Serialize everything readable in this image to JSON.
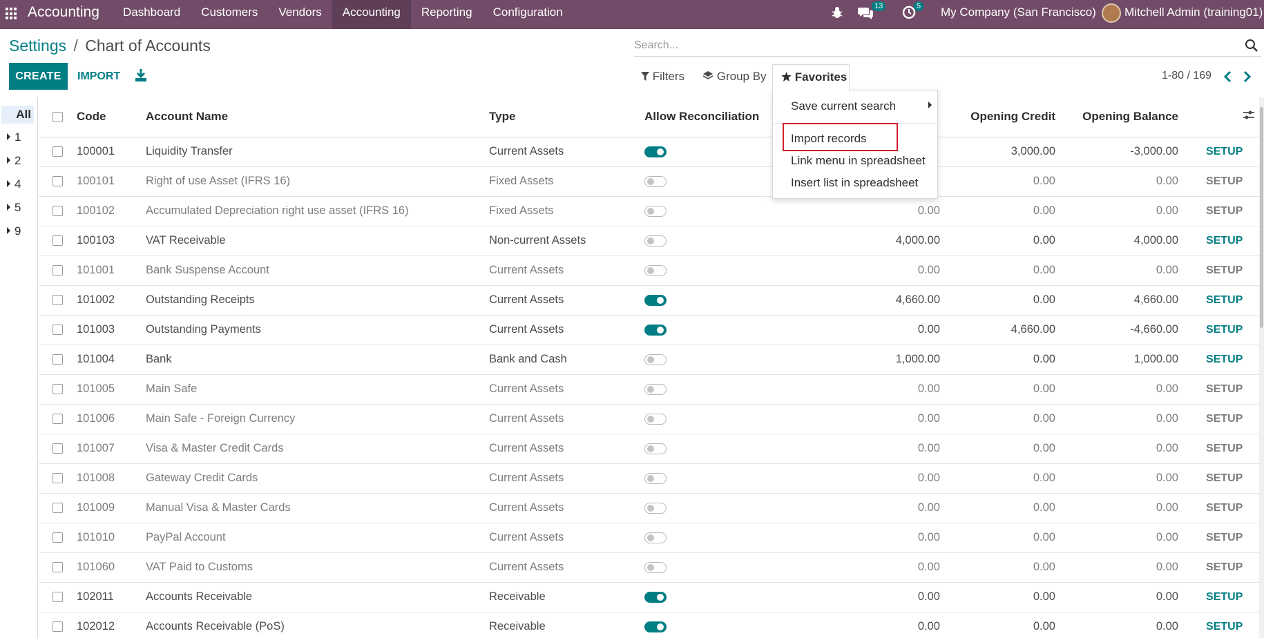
{
  "navbar": {
    "app_name": "Accounting",
    "menu": [
      "Dashboard",
      "Customers",
      "Vendors",
      "Accounting",
      "Reporting",
      "Configuration"
    ],
    "active_menu": "Accounting",
    "messages_count": "13",
    "activities_count": "5",
    "company": "My Company (San Francisco)",
    "user": "Mitchell Admin (training01)"
  },
  "breadcrumb": {
    "parent": "Settings",
    "separator": "/",
    "current": "Chart of Accounts"
  },
  "toolbar": {
    "create_label": "CREATE",
    "import_label": "IMPORT"
  },
  "search": {
    "placeholder": "Search..."
  },
  "filters": {
    "filters_label": "Filters",
    "groupby_label": "Group By",
    "favorites_label": "Favorites"
  },
  "pager": {
    "text": "1-80 / 169"
  },
  "favorites_menu": {
    "items": [
      "Save current search",
      "Import records",
      "Link menu in spreadsheet",
      "Insert list in spreadsheet"
    ]
  },
  "side_panel": {
    "all_label": "All",
    "items": [
      "1",
      "2",
      "4",
      "5",
      "9"
    ]
  },
  "table": {
    "columns": {
      "code": "Code",
      "name": "Account Name",
      "type": "Type",
      "reconcile": "Allow Reconciliation",
      "credit": "Opening Credit",
      "balance": "Opening Balance"
    },
    "setup_label": "SETUP",
    "rows": [
      {
        "code": "100001",
        "name": "Liquidity Transfer",
        "type": "Current Assets",
        "reconcile": true,
        "debit": "",
        "credit": "3,000.00",
        "balance": "-3,000.00"
      },
      {
        "code": "100101",
        "name": "Right of use Asset (IFRS 16)",
        "type": "Fixed Assets",
        "reconcile": false,
        "debit": "",
        "credit": "0.00",
        "balance": "0.00"
      },
      {
        "code": "100102",
        "name": "Accumulated Depreciation right use asset (IFRS 16)",
        "type": "Fixed Assets",
        "reconcile": false,
        "debit": "0.00",
        "credit": "0.00",
        "balance": "0.00"
      },
      {
        "code": "100103",
        "name": "VAT Receivable",
        "type": "Non-current Assets",
        "reconcile": false,
        "debit": "4,000.00",
        "credit": "0.00",
        "balance": "4,000.00"
      },
      {
        "code": "101001",
        "name": "Bank Suspense Account",
        "type": "Current Assets",
        "reconcile": false,
        "debit": "0.00",
        "credit": "0.00",
        "balance": "0.00"
      },
      {
        "code": "101002",
        "name": "Outstanding Receipts",
        "type": "Current Assets",
        "reconcile": true,
        "debit": "4,660.00",
        "credit": "0.00",
        "balance": "4,660.00"
      },
      {
        "code": "101003",
        "name": "Outstanding Payments",
        "type": "Current Assets",
        "reconcile": true,
        "debit": "0.00",
        "credit": "4,660.00",
        "balance": "-4,660.00"
      },
      {
        "code": "101004",
        "name": "Bank",
        "type": "Bank and Cash",
        "reconcile": false,
        "debit": "1,000.00",
        "credit": "0.00",
        "balance": "1,000.00"
      },
      {
        "code": "101005",
        "name": "Main Safe",
        "type": "Current Assets",
        "reconcile": false,
        "debit": "0.00",
        "credit": "0.00",
        "balance": "0.00"
      },
      {
        "code": "101006",
        "name": "Main Safe - Foreign Currency",
        "type": "Current Assets",
        "reconcile": false,
        "debit": "0.00",
        "credit": "0.00",
        "balance": "0.00"
      },
      {
        "code": "101007",
        "name": "Visa & Master Credit Cards",
        "type": "Current Assets",
        "reconcile": false,
        "debit": "0.00",
        "credit": "0.00",
        "balance": "0.00"
      },
      {
        "code": "101008",
        "name": "Gateway Credit Cards",
        "type": "Current Assets",
        "reconcile": false,
        "debit": "0.00",
        "credit": "0.00",
        "balance": "0.00"
      },
      {
        "code": "101009",
        "name": "Manual Visa & Master Cards",
        "type": "Current Assets",
        "reconcile": false,
        "debit": "0.00",
        "credit": "0.00",
        "balance": "0.00"
      },
      {
        "code": "101010",
        "name": "PayPal Account",
        "type": "Current Assets",
        "reconcile": false,
        "debit": "0.00",
        "credit": "0.00",
        "balance": "0.00"
      },
      {
        "code": "101060",
        "name": "VAT Paid to Customs",
        "type": "Current Assets",
        "reconcile": false,
        "debit": "0.00",
        "credit": "0.00",
        "balance": "0.00"
      },
      {
        "code": "102011",
        "name": "Accounts Receivable",
        "type": "Receivable",
        "reconcile": true,
        "debit": "0.00",
        "credit": "0.00",
        "balance": "0.00"
      },
      {
        "code": "102012",
        "name": "Accounts Receivable (PoS)",
        "type": "Receivable",
        "reconcile": true,
        "debit": "0.00",
        "credit": "0.00",
        "balance": "0.00"
      }
    ]
  }
}
